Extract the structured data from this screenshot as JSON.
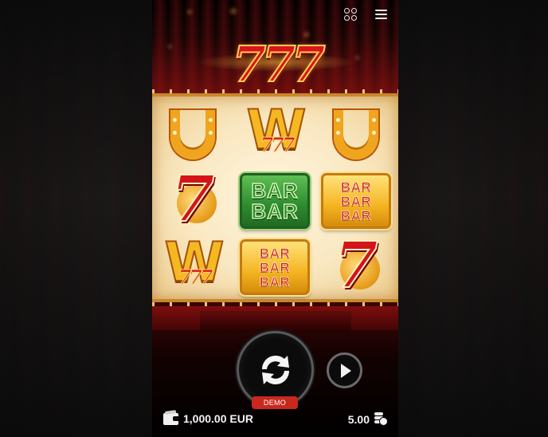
{
  "game": {
    "logo_text": "777",
    "reels": [
      [
        "horseshoe",
        "seven",
        "wild"
      ],
      [
        "wild",
        "bar-bar-green",
        "bar-bar-bar-gold"
      ],
      [
        "horseshoe",
        "bar-bar-bar-gold",
        "seven"
      ]
    ],
    "symbol_text": {
      "wild_letter": "W",
      "wild_sub": "777",
      "seven": "7",
      "bar": "BAR"
    },
    "colors": {
      "accent_gold": "#f0a51e",
      "accent_red": "#d4141a",
      "bar_green": "#2d8a2e",
      "demo_badge": "#c8281e"
    }
  },
  "header": {
    "apps_icon": "apps-icon",
    "menu_icon": "hamburger-menu-icon"
  },
  "controls": {
    "spin_icon": "spin-refresh-icon",
    "demo_label": "DEMO",
    "autoplay_icon": "play-icon"
  },
  "footer": {
    "balance": "1,000.00 EUR",
    "balance_icon": "wallet-icon",
    "bet": "5.00",
    "bet_icon": "coins-icon"
  }
}
